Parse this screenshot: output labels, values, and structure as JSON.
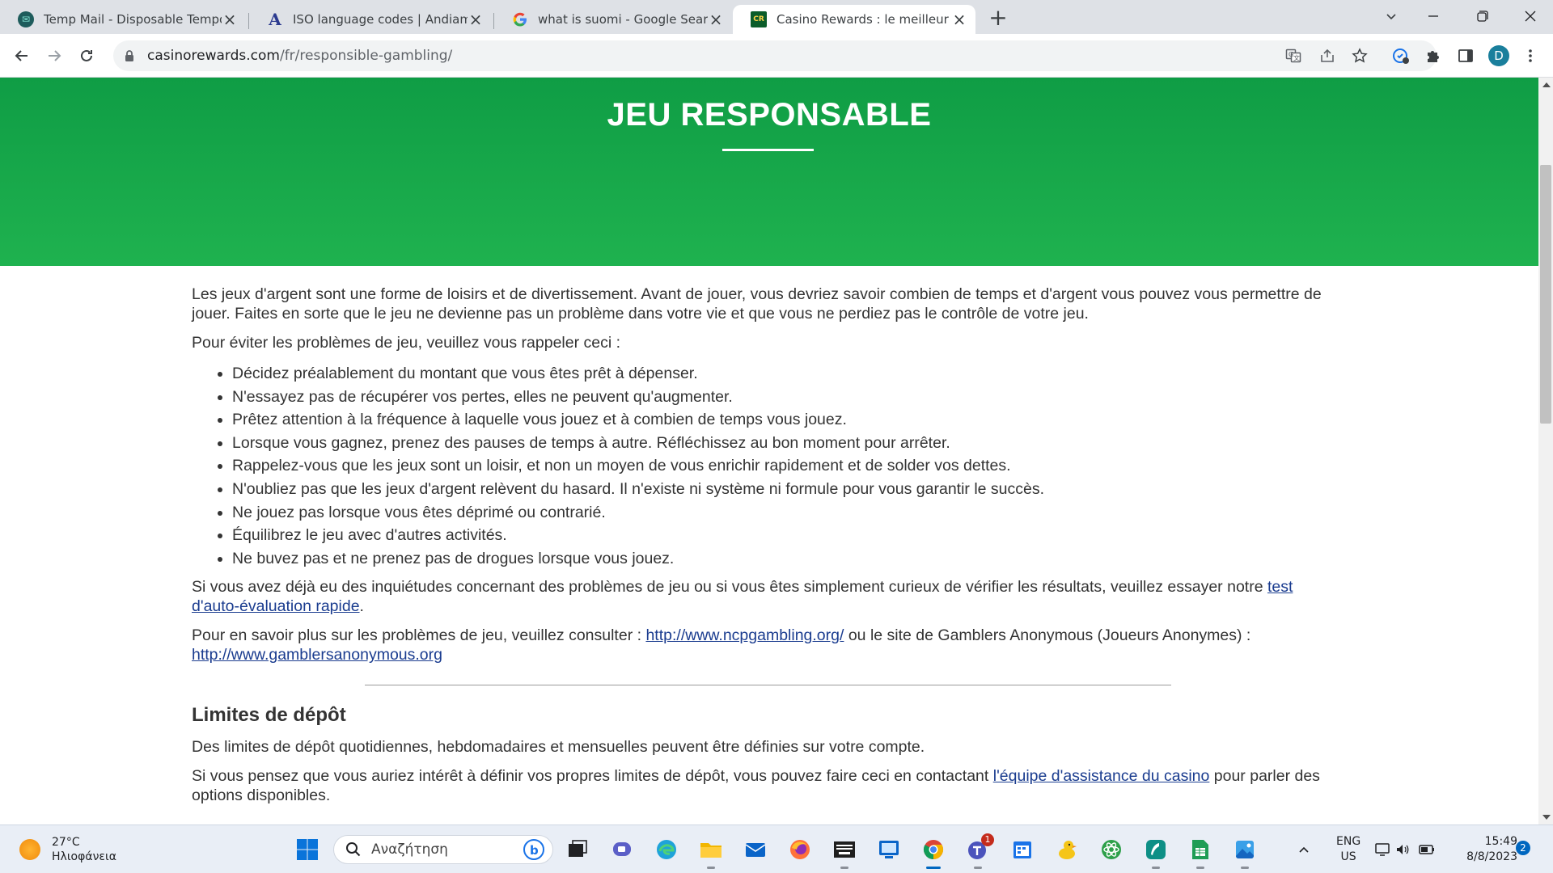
{
  "browser": {
    "tabs": [
      {
        "title": "Temp Mail - Disposable Temporary Email",
        "icon": "tempmail-icon"
      },
      {
        "title": "ISO language codes | Andiamo! Translations",
        "icon": "andiamo-icon"
      },
      {
        "title": "what is suomi - Google Search",
        "icon": "google-icon"
      },
      {
        "title": "Casino Rewards : le meilleur Programme",
        "icon": "casino-rewards-icon"
      }
    ],
    "new_tab": "+",
    "url_host": "casinorewards.com",
    "url_path": "/fr/responsible-gambling/",
    "profile_initial": "D"
  },
  "page": {
    "hero_title": "JEU RESPONSABLE",
    "intro": "Les jeux d'argent sont une forme de loisirs et de divertissement. Avant de jouer, vous devriez savoir combien de temps et d'argent vous pouvez vous permettre de jouer. Faites en sorte que le jeu ne devienne pas un problème dans votre vie et que vous ne perdiez pas le contrôle de votre jeu.",
    "lead": "Pour éviter les problèmes de jeu, veuillez vous rappeler ceci :",
    "tips": [
      "Décidez préalablement du montant que vous êtes prêt à dépenser.",
      "N'essayez pas de récupérer vos pertes, elles ne peuvent qu'augmenter.",
      "Prêtez attention à la fréquence à laquelle vous jouez et à combien de temps vous jouez.",
      "Lorsque vous gagnez, prenez des pauses de temps à autre. Réfléchissez au bon moment pour arrêter.",
      "Rappelez-vous que les jeux sont un loisir, et non un moyen de vous enrichir rapidement et de solder vos dettes.",
      "N'oubliez pas que les jeux d'argent relèvent du hasard. Il n'existe ni système ni formule pour vous garantir le succès.",
      "Ne jouez pas lorsque vous êtes déprimé ou contrarié.",
      "Équilibrez le jeu avec d'autres activités.",
      "Ne buvez pas et ne prenez pas de drogues lorsque vous jouez."
    ],
    "self_test_text": "Si vous avez déjà eu des inquiétudes concernant des problèmes de jeu ou si vous êtes simplement curieux de vérifier les résultats, veuillez essayer notre ",
    "self_test_link": "test d'auto-évaluation rapide",
    "self_test_end": ".",
    "learn_more_text": "Pour en savoir plus sur les problèmes de jeu, veuillez consulter : ",
    "ncpg_link": "http://www.ncpgambling.org/",
    "learn_more_mid": " ou le site de Gamblers Anonymous (Joueurs Anonymes) : ",
    "ga_link": "http://www.gamblersanonymous.org",
    "deposit_heading": "Limites de dépôt",
    "deposit_text": "Des limites de dépôt quotidiennes, hebdomadaires et mensuelles peuvent être définies sur votre compte.",
    "deposit_contact_text": "Si vous pensez que vous auriez intérêt à définir vos propres limites de dépôt, vous pouvez faire ceci en contactant ",
    "support_link": "l'équipe d'assistance du casino",
    "deposit_contact_end": " pour parler des options disponibles."
  },
  "taskbar": {
    "temperature": "27°C",
    "weather": "Ηλιοφάνεια",
    "search_placeholder": "Αναζήτηση",
    "lang_top": "ENG",
    "lang_bottom": "US",
    "time": "15:49",
    "date": "8/8/2023",
    "notifications": "2",
    "teams_badge": "1"
  },
  "colors": {
    "hero_green": "#1fb24f",
    "link": "#1a3c8f",
    "accent": "#0067c0"
  }
}
